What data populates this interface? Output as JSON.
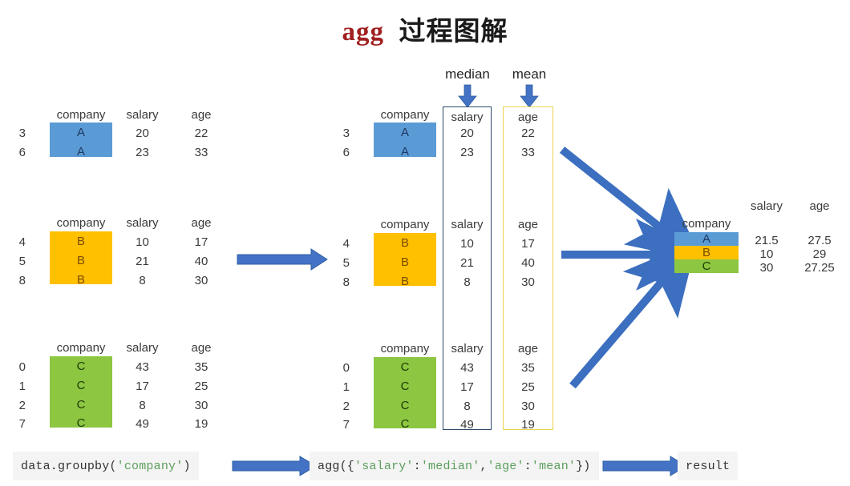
{
  "title": {
    "code_part": "agg",
    "cn_part": "过程图解"
  },
  "columns": {
    "company": "company",
    "salary": "salary",
    "age": "age"
  },
  "agg_labels": {
    "median": "median",
    "mean": "mean"
  },
  "groups": [
    {
      "key": "A",
      "color": "#5B9BD5",
      "indices": [
        "3",
        "6"
      ],
      "company": [
        "A",
        "A"
      ],
      "salary": [
        "20",
        "23"
      ],
      "age": [
        "22",
        "33"
      ]
    },
    {
      "key": "B",
      "color": "#FFC000",
      "indices": [
        "4",
        "5",
        "8"
      ],
      "company": [
        "B",
        "B",
        "B"
      ],
      "salary": [
        "10",
        "21",
        "8"
      ],
      "age": [
        "17",
        "40",
        "30"
      ]
    },
    {
      "key": "C",
      "color": "#8DC641",
      "indices": [
        "0",
        "1",
        "2",
        "7"
      ],
      "company": [
        "C",
        "C",
        "C",
        "C"
      ],
      "salary": [
        "43",
        "17",
        "8",
        "49"
      ],
      "age": [
        "35",
        "25",
        "30",
        "19"
      ]
    }
  ],
  "result": {
    "company_header": "company",
    "salary_header": "salary",
    "age_header": "age",
    "rows": [
      {
        "company": "A",
        "salary": "21.5",
        "age": "27.5",
        "color": "#5B9BD5"
      },
      {
        "company": "B",
        "salary": "10",
        "age": "29",
        "color": "#FFC000"
      },
      {
        "company": "C",
        "salary": "30",
        "age": "27.25",
        "color": "#8DC641"
      }
    ]
  },
  "pipeline": {
    "step1": {
      "pre": "data.groupby(",
      "str": "'company'",
      "post": ")"
    },
    "step2": {
      "pre": "agg({",
      "str1": "'salary'",
      "mid1": ":",
      "str2": "'median'",
      "mid2": ",",
      "str3": "'age'",
      "mid3": ":",
      "str4": "'mean'",
      "post": "})"
    },
    "step3": {
      "label": "result"
    }
  },
  "colors": {
    "accent_blue": "#4472C4",
    "arrow_blue": "#3C6FBF",
    "outline_navy": "#2E4A6B",
    "outline_gold": "#E8D44D",
    "title_red": "#A02020"
  }
}
